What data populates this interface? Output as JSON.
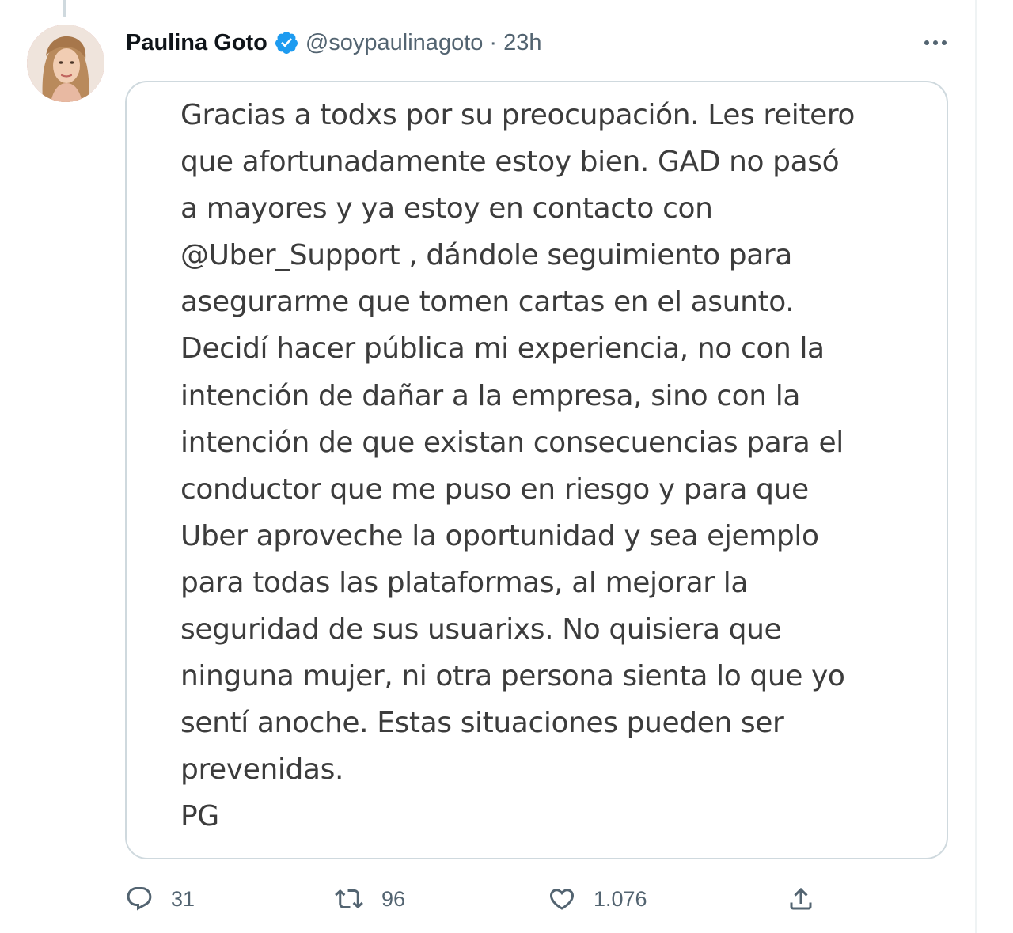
{
  "tweet": {
    "author": {
      "name": "Paulina Goto",
      "handle": "@soypaulinagoto",
      "verified": true
    },
    "separator": "·",
    "time": "23h",
    "statement_lines": [
      "Gracias a todxs por su preocupación. Les reitero",
      "que afortunadamente estoy bien. GAD no pasó",
      "a mayores y ya estoy en contacto con",
      "@Uber_Support , dándole seguimiento para",
      "asegurarme que tomen cartas en el asunto.",
      "Decidí hacer pública mi experiencia, no con la",
      "intención de dañar a la empresa, sino con la",
      "intención de que existan consecuencias para el",
      "conductor que me puso en riesgo y para que",
      "Uber aproveche la oportunidad y sea ejemplo",
      "para todas las plataformas, al mejorar la",
      "seguridad de sus usuarixs. No quisiera que",
      "ninguna mujer, ni otra persona sienta lo que yo",
      "sentí anoche. Estas situaciones pueden ser",
      "prevenidas.",
      "PG"
    ],
    "actions": {
      "replies": "31",
      "retweets": "96",
      "likes": "1.076"
    }
  },
  "icons": {
    "verified": "verified-badge-icon",
    "more": "more-dots-icon",
    "reply": "reply-icon",
    "retweet": "retweet-icon",
    "like": "heart-icon",
    "share": "share-icon"
  },
  "colors": {
    "verified_blue": "#1d9bf0",
    "secondary_text": "#536471",
    "primary_text": "#0f1419",
    "card_border": "#cfd9de"
  }
}
